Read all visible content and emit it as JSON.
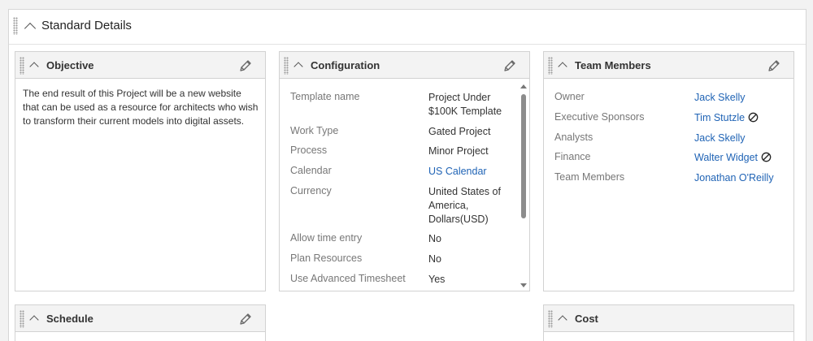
{
  "section": {
    "title": "Standard Details"
  },
  "objective": {
    "title": "Objective",
    "text": "The end result of this Project will be a new website that can be used as a resource for architects who wish to transform their current models into digital assets."
  },
  "configuration": {
    "title": "Configuration",
    "rows": [
      {
        "label": "Template name",
        "value": "Project Under $100K Template",
        "link": false
      },
      {
        "label": "Work Type",
        "value": "Gated Project",
        "link": false
      },
      {
        "label": "Process",
        "value": "Minor Project",
        "link": false
      },
      {
        "label": "Calendar",
        "value": "US Calendar",
        "link": true
      },
      {
        "label": "Currency",
        "value": "United States of America, Dollars(USD)",
        "link": false
      },
      {
        "label": "Allow time entry",
        "value": "No",
        "link": false
      },
      {
        "label": "Plan Resources",
        "value": "No",
        "link": false
      },
      {
        "label": "Use Advanced Timesheet",
        "value": "Yes",
        "link": false
      }
    ]
  },
  "team": {
    "title": "Team Members",
    "rows": [
      {
        "label": "Owner",
        "value": "Jack Skelly",
        "inactive": false
      },
      {
        "label": "Executive Sponsors",
        "value": "Tim Stutzle",
        "inactive": true
      },
      {
        "label": "Analysts",
        "value": "Jack Skelly",
        "inactive": false
      },
      {
        "label": "Finance",
        "value": "Walter Widget",
        "inactive": true
      },
      {
        "label": "Team Members",
        "value": "Jonathan O'Reilly",
        "inactive": false
      }
    ]
  },
  "schedule": {
    "title": "Schedule"
  },
  "cost": {
    "title": "Cost"
  },
  "icons": {
    "collapse": "chevron-up-icon",
    "edit": "pencil-icon",
    "drag": "drag-handle-icon",
    "inactive": "no-entry-icon"
  },
  "colors": {
    "link": "#1f63b5",
    "label": "#777777",
    "header_bg": "#f3f3f3"
  }
}
